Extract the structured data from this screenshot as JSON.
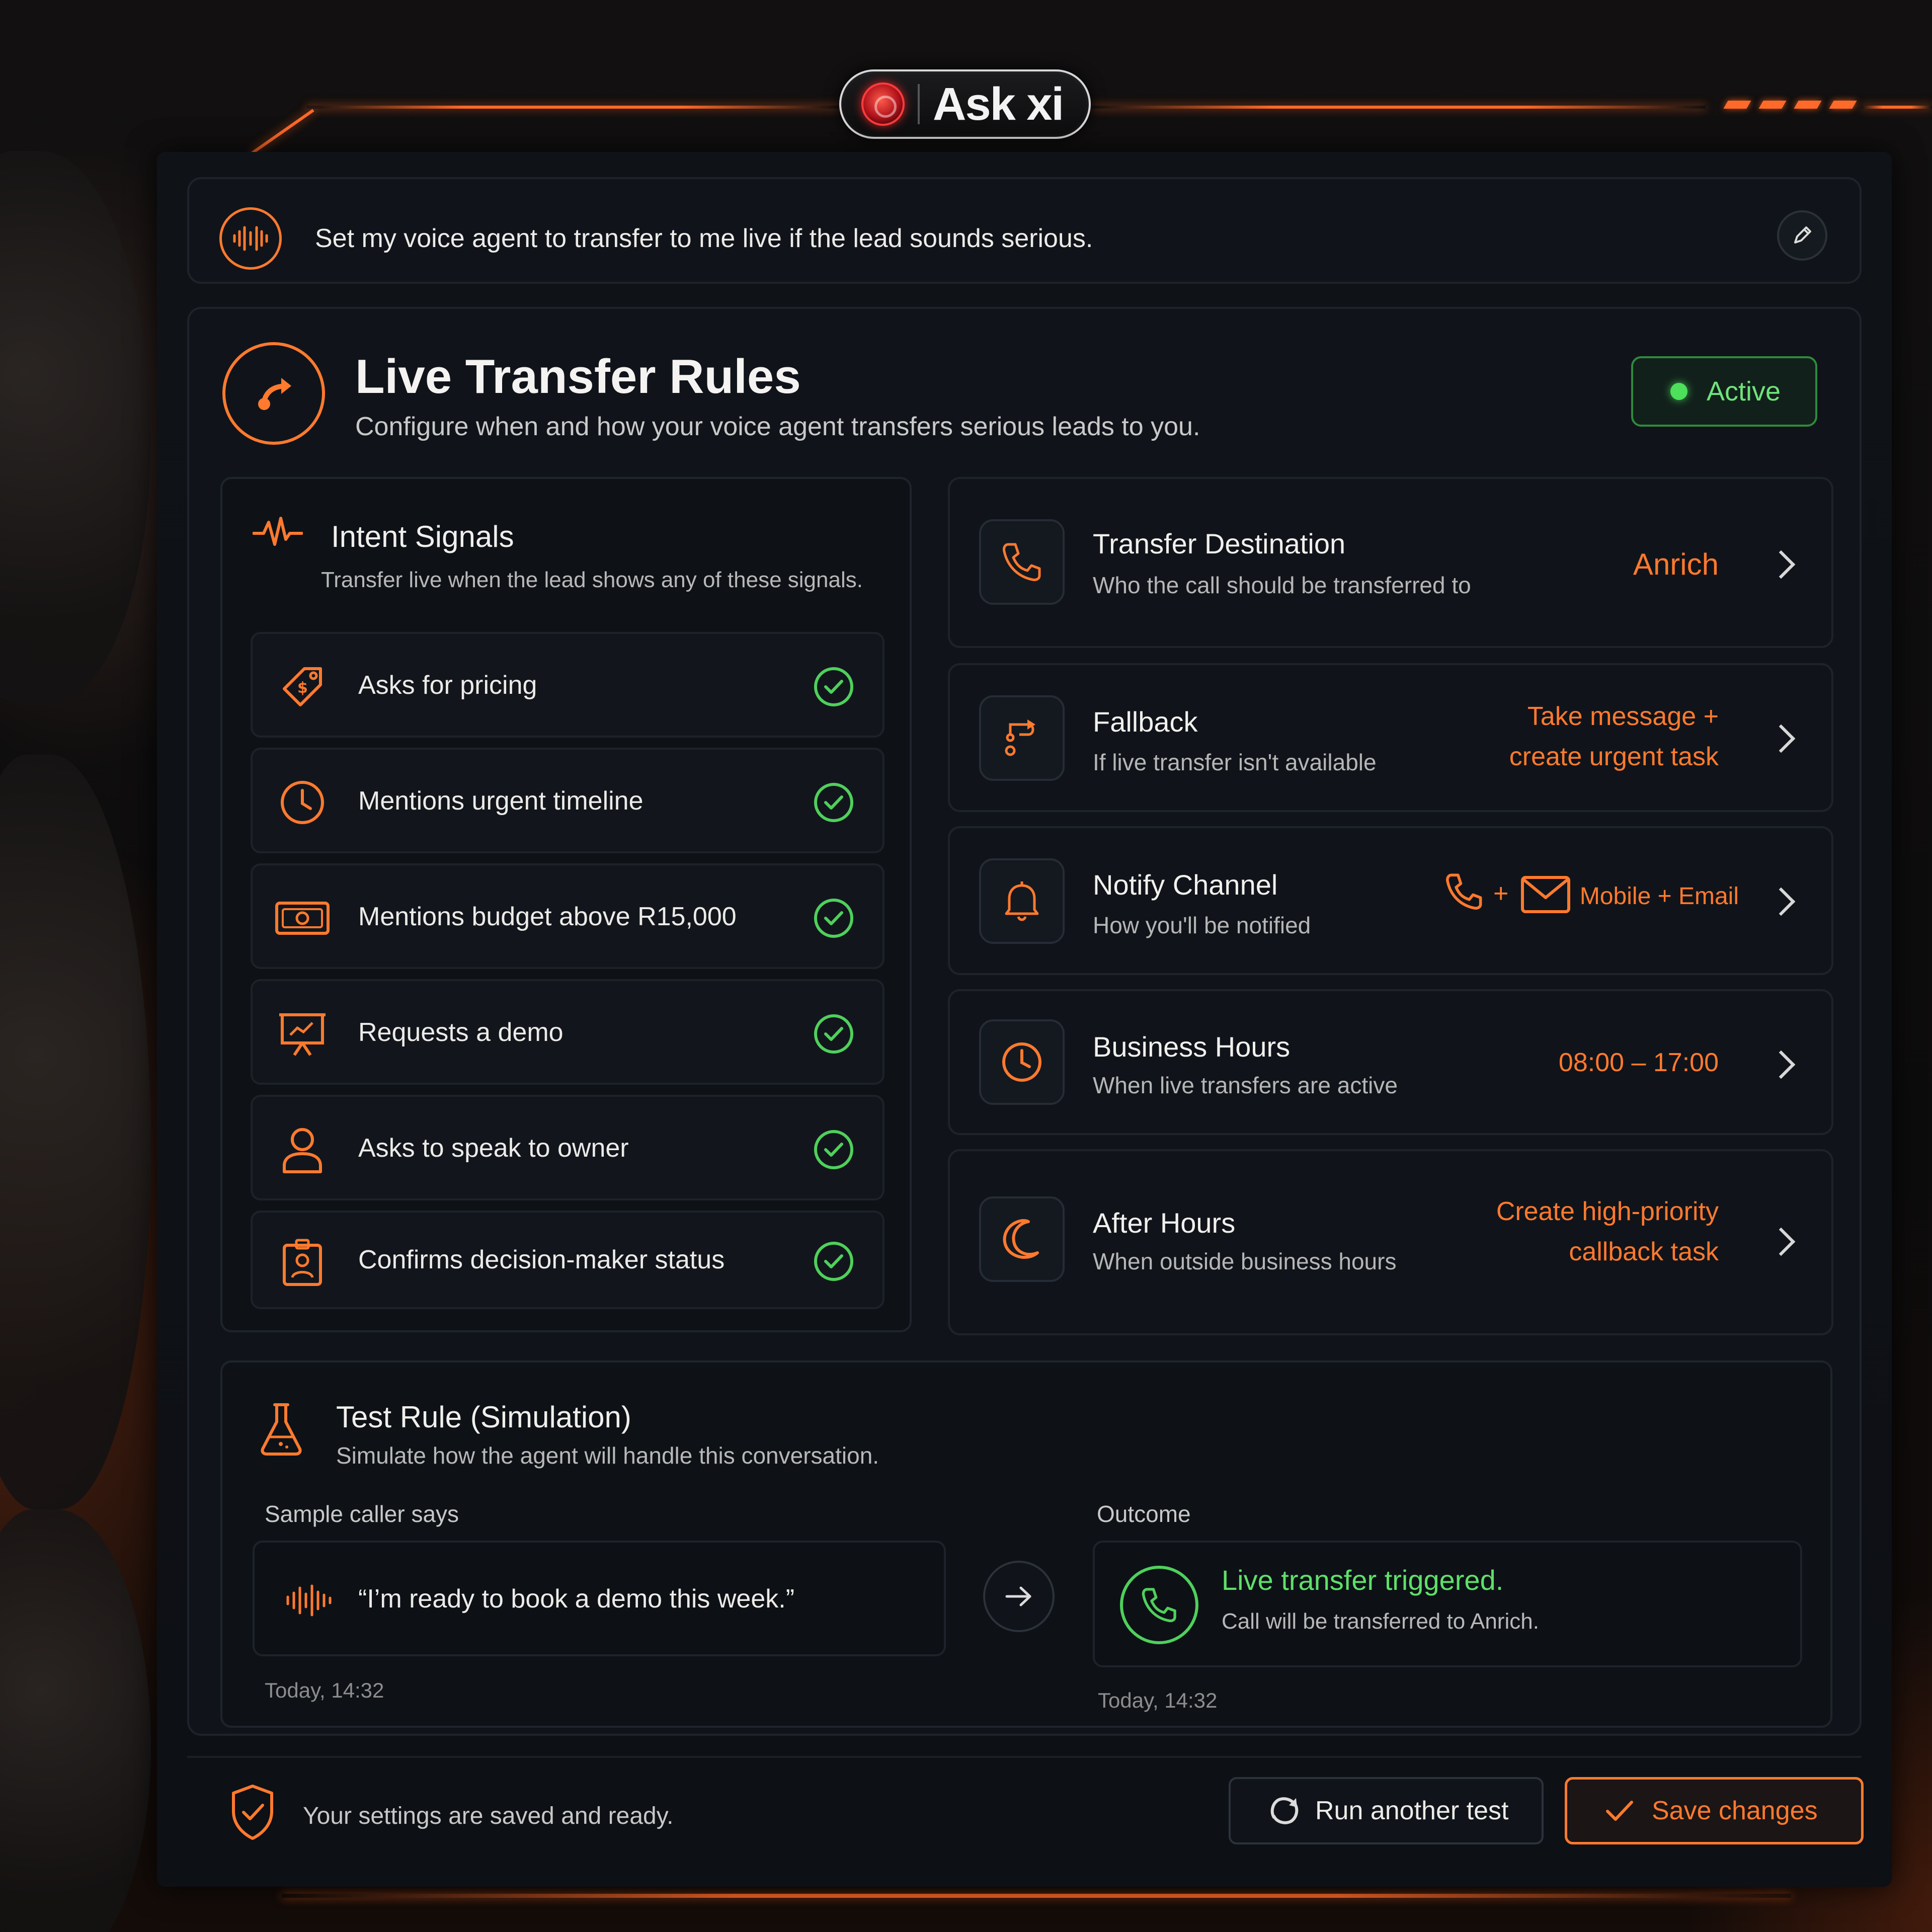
{
  "brand": {
    "name": "Ask xi"
  },
  "prompt": {
    "text": "Set my voice agent to transfer to me live if the lead sounds serious."
  },
  "header": {
    "title": "Live Transfer Rules",
    "subtitle": "Configure when and how your voice agent transfers serious leads to you.",
    "status": "Active"
  },
  "intent_signals": {
    "title": "Intent Signals",
    "subtitle": "Transfer live when the lead shows any of these signals.",
    "items": [
      {
        "label": "Asks for pricing",
        "icon": "price-tag-icon",
        "checked": true
      },
      {
        "label": "Mentions urgent timeline",
        "icon": "clock-icon",
        "checked": true
      },
      {
        "label": "Mentions budget above R15,000",
        "icon": "money-icon",
        "checked": true
      },
      {
        "label": "Requests a demo",
        "icon": "presentation-icon",
        "checked": true
      },
      {
        "label": "Asks to speak to owner",
        "icon": "user-icon",
        "checked": true
      },
      {
        "label": "Confirms decision-maker status",
        "icon": "id-badge-icon",
        "checked": true
      }
    ]
  },
  "rules": [
    {
      "title": "Transfer Destination",
      "subtitle": "Who the call should be transferred to",
      "value_lines": [
        "Anrich"
      ],
      "icon": "phone-icon"
    },
    {
      "title": "Fallback",
      "subtitle": "If live transfer isn't available",
      "value_lines": [
        "Take message +",
        "create urgent task"
      ],
      "icon": "route-icon"
    },
    {
      "title": "Notify Channel",
      "subtitle": "How you'll be notified",
      "value_lines": [
        "Mobile + Email"
      ],
      "icon": "bell-icon"
    },
    {
      "title": "Business Hours",
      "subtitle": "When live transfers are active",
      "value_lines": [
        "08:00 – 17:00"
      ],
      "icon": "clock-icon"
    },
    {
      "title": "After Hours",
      "subtitle": "When outside business hours",
      "value_lines": [
        "Create high-priority",
        "callback task"
      ],
      "icon": "moon-icon"
    }
  ],
  "notify_plus": "+",
  "test": {
    "title": "Test Rule (Simulation)",
    "subtitle": "Simulate how the agent will handle this conversation.",
    "sample_label": "Sample caller says",
    "sample_quote": "“I’m ready to book a demo this week.”",
    "sample_time": "Today, 14:32",
    "outcome_label": "Outcome",
    "outcome_title": "Live transfer triggered.",
    "outcome_sub": "Call will be transferred to Anrich.",
    "outcome_time": "Today, 14:32"
  },
  "footer": {
    "status": "Your settings are saved and ready.",
    "run_label": "Run another test",
    "save_label": "Save changes"
  },
  "colors": {
    "accent": "#ff7a2e",
    "success": "#5fe06a",
    "panel": "#0f1217"
  }
}
